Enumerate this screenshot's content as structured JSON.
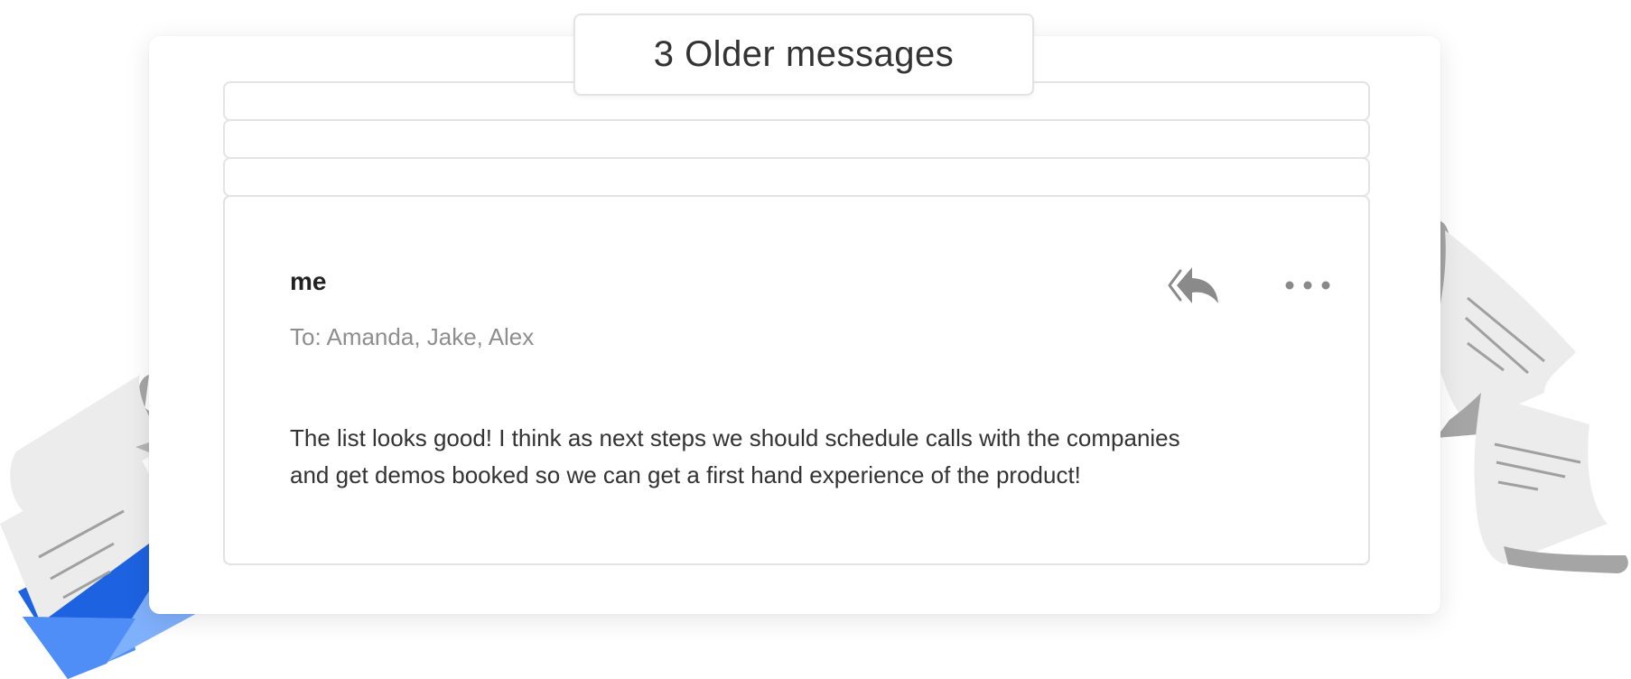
{
  "thread": {
    "older_messages_label": "3 Older messages"
  },
  "message": {
    "sender": "me",
    "recipients": "To: Amanda, Jake, Alex",
    "body_line1": "The list looks good! I think as next steps we should schedule calls with the companies",
    "body_line2": "and get demos booked so we can get a first hand experience of the product!",
    "actions": {
      "reply_all_icon": "reply-all-icon",
      "more_icon": "more-options-icon"
    }
  },
  "colors": {
    "envelope_blue": "#4f8ef7",
    "envelope_light_blue": "#7fb0fb",
    "paper": "#ededed",
    "paper_shadow": "#a3a3a3",
    "icon_gray": "#888888"
  }
}
